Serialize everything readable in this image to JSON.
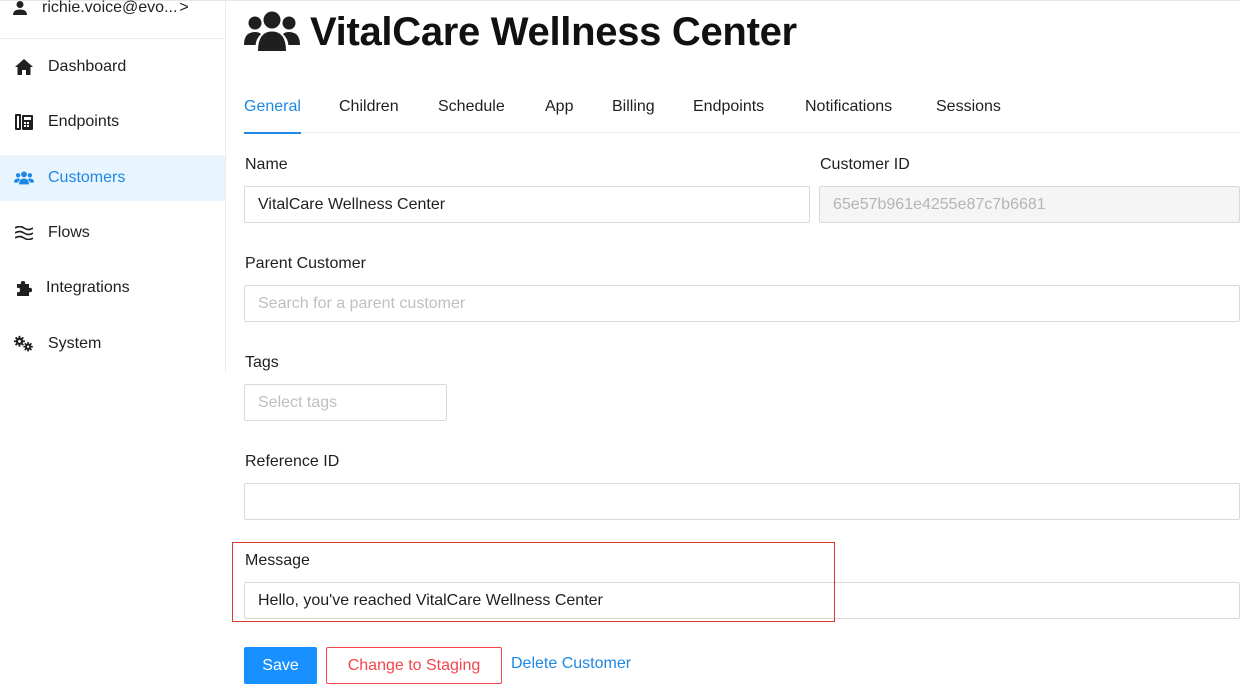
{
  "user": {
    "email": "richie.voice@evo...",
    "chevron": ">"
  },
  "sidebar": {
    "items": [
      {
        "label": "Dashboard",
        "icon": "home-icon"
      },
      {
        "label": "Endpoints",
        "icon": "endpoints-icon"
      },
      {
        "label": "Customers",
        "icon": "users-icon",
        "active": true
      },
      {
        "label": "Flows",
        "icon": "water-icon"
      },
      {
        "label": "Integrations",
        "icon": "puzzle-icon"
      },
      {
        "label": "System",
        "icon": "cogs-icon"
      }
    ]
  },
  "page": {
    "title": "VitalCare Wellness Center",
    "title_icon": "users-icon"
  },
  "tabs": [
    {
      "label": "General",
      "active": true
    },
    {
      "label": "Children"
    },
    {
      "label": "Schedule"
    },
    {
      "label": "App"
    },
    {
      "label": "Billing"
    },
    {
      "label": "Endpoints"
    },
    {
      "label": "Notifications"
    },
    {
      "label": "Sessions"
    }
  ],
  "form": {
    "name": {
      "label": "Name",
      "value": "VitalCare Wellness Center"
    },
    "customer_id": {
      "label": "Customer ID",
      "value": "65e57b961e4255e87c7b6681"
    },
    "parent_customer": {
      "label": "Parent Customer",
      "placeholder": "Search for a parent customer",
      "value": ""
    },
    "tags": {
      "label": "Tags",
      "placeholder": "Select tags",
      "value": ""
    },
    "reference_id": {
      "label": "Reference ID",
      "value": ""
    },
    "message": {
      "label": "Message",
      "value": "Hello, you've reached VitalCare Wellness Center"
    }
  },
  "actions": {
    "save": "Save",
    "change_staging": "Change to Staging",
    "delete": "Delete Customer"
  },
  "colors": {
    "accent": "#1890ff",
    "danger": "#f5444e",
    "highlight": "#d93a2b",
    "active_bg": "#e8f4fe"
  }
}
